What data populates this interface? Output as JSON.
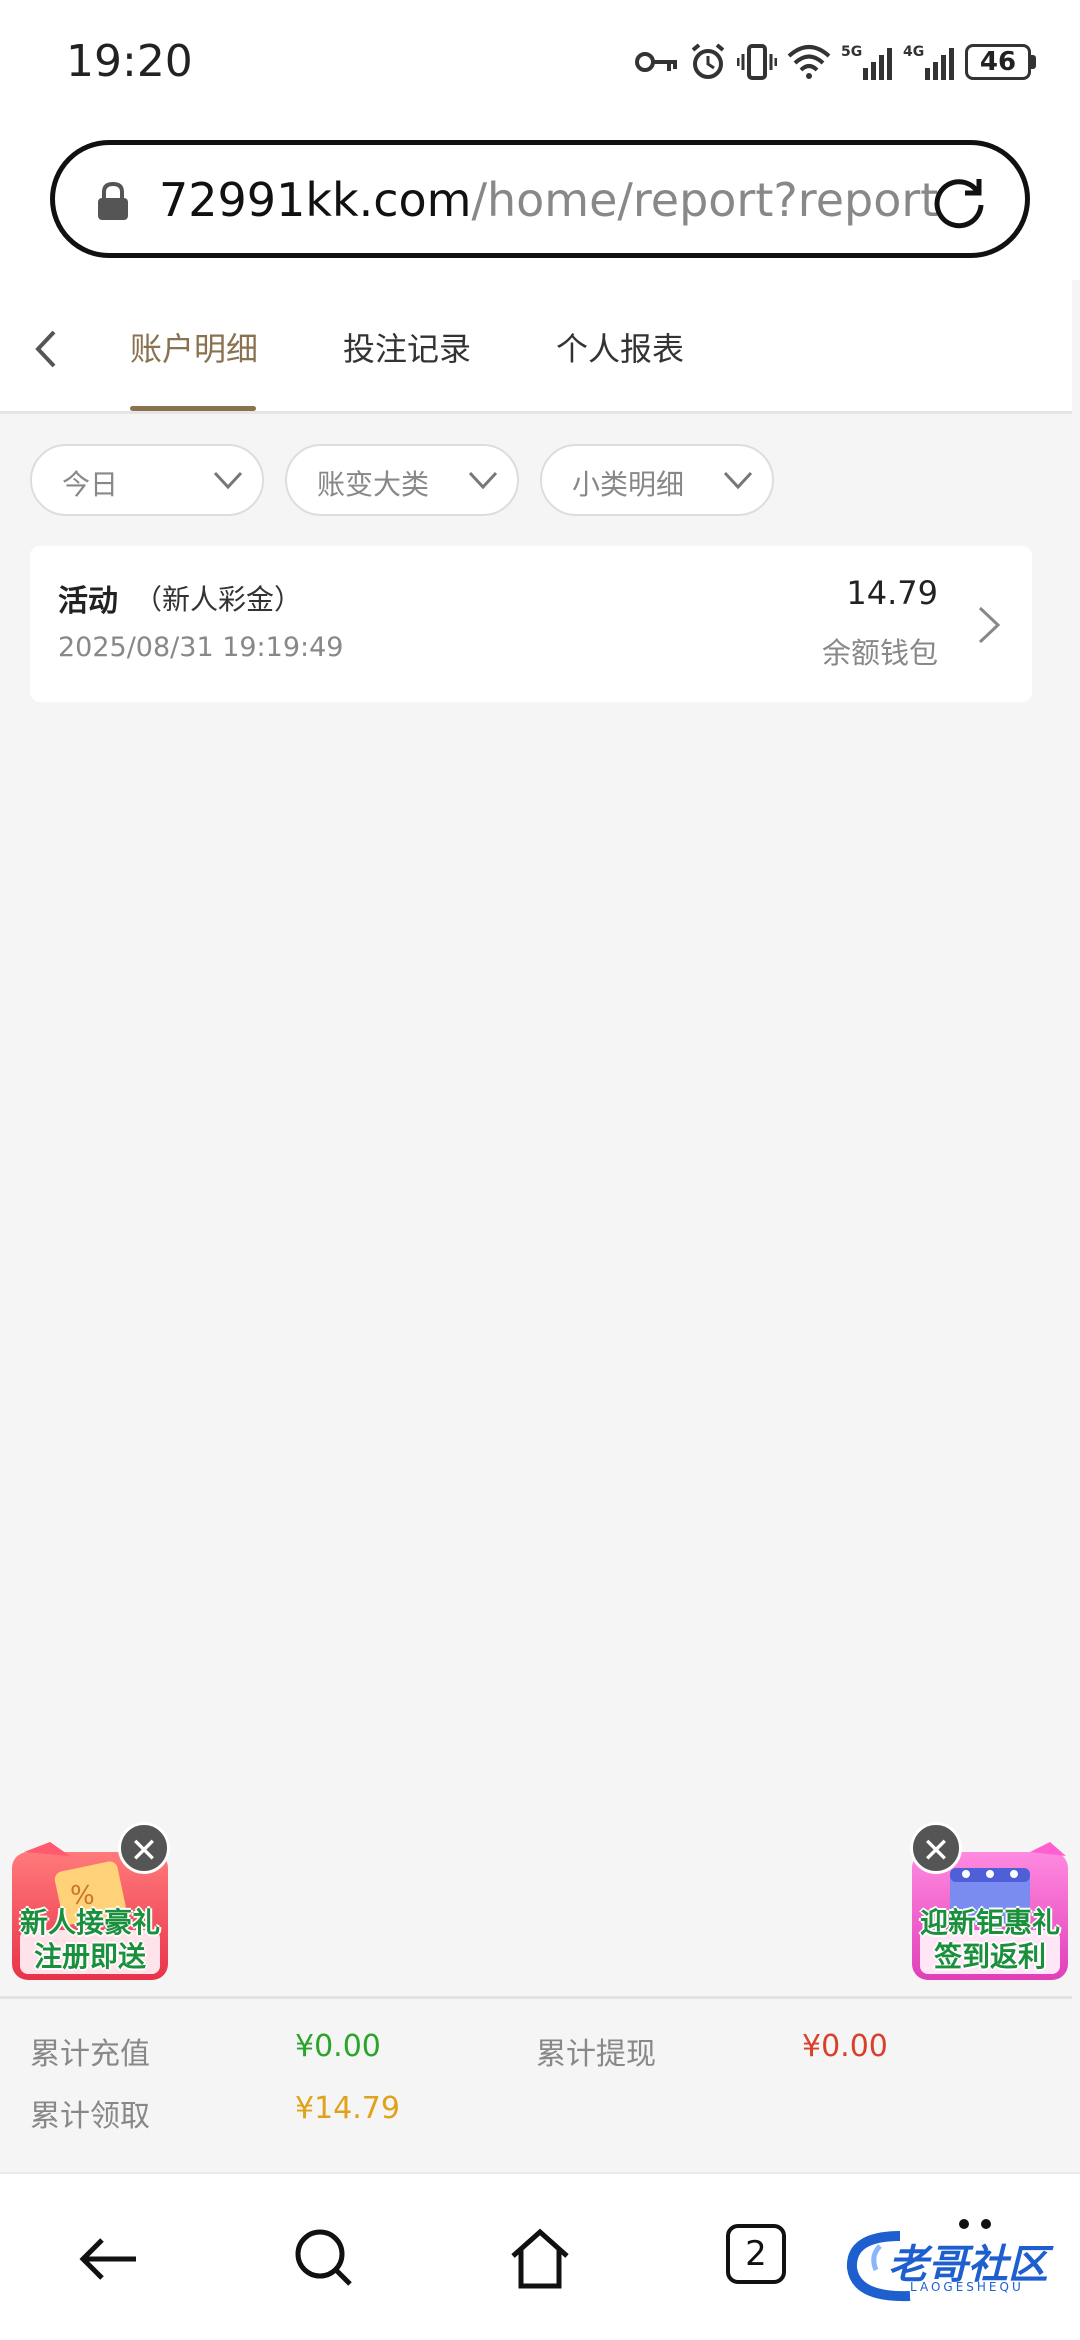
{
  "status_bar": {
    "time": "19:20",
    "battery": "46",
    "icons": [
      "key-icon",
      "alarm-icon",
      "vibrate-icon",
      "wifi-icon",
      "signal-5g-icon",
      "signal-4g-icon",
      "battery-icon"
    ],
    "net1": "5G",
    "net2": "4G"
  },
  "browser": {
    "url_host": "72991kk.com",
    "url_path": "/home/report?report"
  },
  "tabs": [
    {
      "label": "账户明细",
      "active": true
    },
    {
      "label": "投注记录",
      "active": false
    },
    {
      "label": "个人报表",
      "active": false
    }
  ],
  "filters": [
    {
      "label": "今日"
    },
    {
      "label": "账变大类"
    },
    {
      "label": "小类明细"
    }
  ],
  "records": [
    {
      "title": "活动",
      "subtitle": "（新人彩金）",
      "time": "2025/08/31 19:19:49",
      "amount": "14.79",
      "wallet": "余额钱包"
    }
  ],
  "promos": {
    "left": {
      "line1": "新人接豪礼",
      "line2": "注册即送"
    },
    "right": {
      "line1": "迎新钜惠礼",
      "line2": "签到返利"
    },
    "close": "✕"
  },
  "totals": {
    "recharge_label": "累计充值",
    "recharge_value": "¥0.00",
    "withdraw_label": "累计提现",
    "withdraw_value": "¥0.00",
    "claim_label": "累计领取",
    "claim_value": "¥14.79"
  },
  "bottom_nav": {
    "tab_count": "2"
  },
  "watermark": {
    "text": "老哥社区",
    "sub": "LAOGESHEQU"
  },
  "colors": {
    "accent": "#8a7250",
    "recharge": "#2aa52a",
    "withdraw": "#d9402b",
    "claim": "#e0a21a"
  }
}
